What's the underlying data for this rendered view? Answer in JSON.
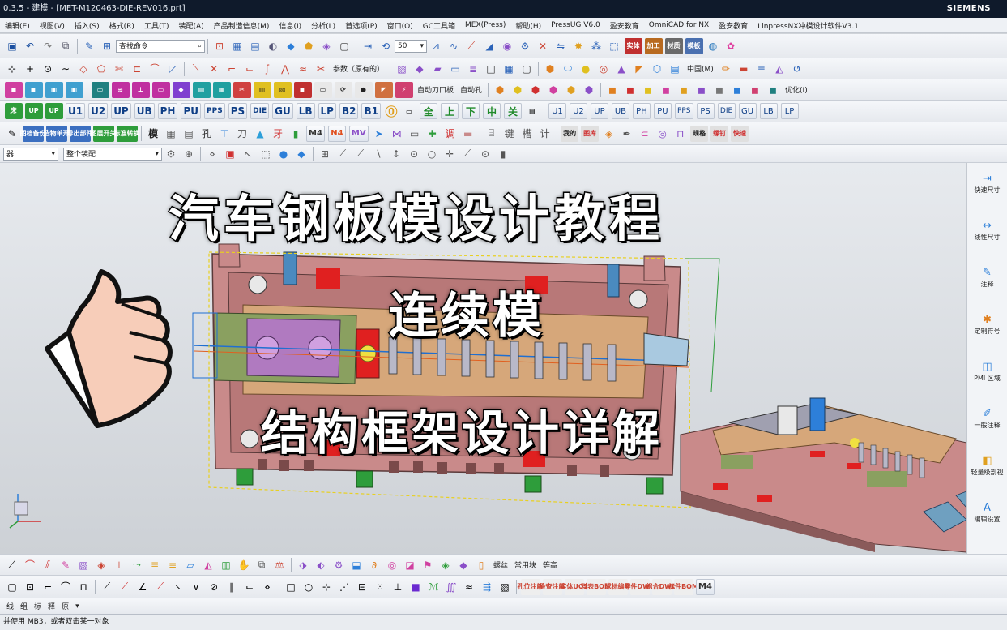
{
  "titlebar": {
    "text": "0.3.5 - 建模 - [MET-M120463-DIE-REV016.prt]",
    "brand": "SIEMENS"
  },
  "menu": {
    "items": [
      "编辑(E)",
      "视图(V)",
      "插入(S)",
      "格式(R)",
      "工具(T)",
      "装配(A)",
      "产品制造信息(M)",
      "信息(I)",
      "分析(L)",
      "首选项(P)",
      "窗口(O)",
      "GC工具箱",
      "MEX(Press)",
      "帮助(H)",
      "PressUG V6.0",
      "盈安教育",
      "OmniCAD for NX",
      "盈安教育",
      "LinpressNX冲模设计软件V3.1"
    ]
  },
  "toolbar1": {
    "search_placeholder": "查找命令",
    "zoom_value": "50",
    "labels": [
      "实体",
      "加工",
      "材质",
      "模板"
    ]
  },
  "toolbar2": {
    "param_label": "参数（原有的）",
    "chinese_menu": "中国(M)"
  },
  "toolbar3": {
    "labels": [
      "自动刀口板",
      "自动孔",
      "优化(I)"
    ]
  },
  "toolbar4": {
    "plate_labels": [
      "U1",
      "U2",
      "UP",
      "UB",
      "PH",
      "PU",
      "PPS",
      "PS",
      "DIE",
      "GU",
      "LB",
      "LP",
      "B2",
      "B1"
    ],
    "chinese_plates": [
      "上",
      "下",
      "中",
      "关"
    ],
    "right_plates": [
      "U1",
      "U2",
      "UP",
      "UB",
      "PH",
      "PU",
      "PPS",
      "PS",
      "DIE",
      "GU",
      "LB",
      "LP"
    ]
  },
  "toolbar5": {
    "labels": [
      "图档备份",
      "造物单开",
      "导出部件",
      "图层开关",
      "标准转换",
      "M4",
      "N4",
      "MV"
    ]
  },
  "selection": {
    "filter_value": "整个装配",
    "left_field": "器"
  },
  "headlines": {
    "main": "汽车钢板模设计教程",
    "sub1": "连续模",
    "sub2": "结构框架设计详解"
  },
  "rightpanel": {
    "items": [
      {
        "label": "快速尺寸",
        "icon": "quick-dim-icon"
      },
      {
        "label": "线性尺寸",
        "icon": "linear-dim-icon"
      },
      {
        "label": "注释",
        "icon": "note-icon"
      },
      {
        "label": "定制符号",
        "icon": "custom-symbol-icon"
      },
      {
        "label": "PMI 区域",
        "icon": "pmi-icon"
      },
      {
        "label": "一般注释",
        "icon": "general-note-icon"
      },
      {
        "label": "轻量级剖视",
        "icon": "section-icon"
      },
      {
        "label": "编辑设置",
        "icon": "edit-settings-icon"
      }
    ]
  },
  "bottombar1": {
    "labels": [
      "螺丝",
      "常用块",
      "等高"
    ]
  },
  "bottombar2": {
    "labels": [
      "孔位注解",
      "检查注解",
      "实体UCS",
      "料表BOM",
      "球标编号",
      "零件DWG",
      "组合DWG",
      "标件BOM",
      "M4"
    ]
  },
  "bottombar3": {
    "labels": [
      "线",
      "组",
      "标",
      "释",
      "原"
    ]
  },
  "status": {
    "text": "并使用 MB3，或者双击某一对象"
  },
  "colors": {
    "plate": "#c98a8a",
    "accent_red": "#e02020",
    "green": "#2e9d3b",
    "highlight": "#f0e040",
    "blue": "#2d7fd9"
  }
}
